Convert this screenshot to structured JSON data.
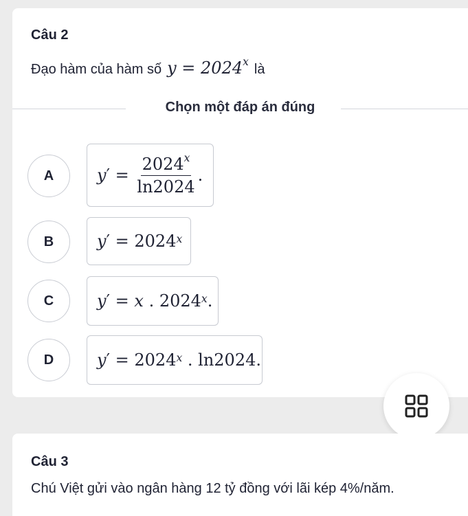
{
  "question2": {
    "title": "Câu 2",
    "text_prefix": "Đạo hàm của hàm số",
    "text_math": "y = 2024",
    "text_exp": "x",
    "text_suffix": "là"
  },
  "divider": {
    "label": "Chọn một đáp án đúng"
  },
  "options": [
    {
      "letter": "A",
      "math": "y′ = 2024^x / ln2024."
    },
    {
      "letter": "B",
      "math": "y′ = 2024^x"
    },
    {
      "letter": "C",
      "math": "y′ = x . 2024^x."
    },
    {
      "letter": "D",
      "math": "y′ = 2024^x . ln2024."
    }
  ],
  "grid_button": {
    "icon": "grid-icon"
  },
  "question3": {
    "title": "Câu 3",
    "text": "Chú Việt gửi vào ngân hàng 12 tỷ đồng với lãi kép 4%/năm."
  }
}
